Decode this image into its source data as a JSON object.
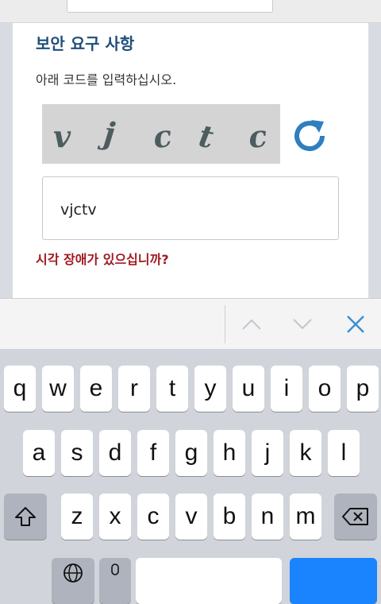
{
  "security": {
    "title": "보안 요구 사항",
    "instruction": "아래 코드를 입력하십시오.",
    "captcha_chars": [
      "v",
      "j",
      "c",
      "t",
      "c"
    ],
    "answer_value": "vjctv",
    "accessibility_link": "시각 장애가 있으십니까?"
  },
  "accessory_bar": {
    "prev_icon": "chevron-up-icon",
    "next_icon": "chevron-down-icon",
    "close_icon": "close-icon",
    "accent": "#3d8fd0"
  },
  "keyboard": {
    "row1": [
      "q",
      "w",
      "e",
      "r",
      "t",
      "y",
      "u",
      "i",
      "o",
      "p"
    ],
    "row2": [
      "a",
      "s",
      "d",
      "f",
      "g",
      "h",
      "j",
      "k",
      "l"
    ],
    "row3": [
      "z",
      "x",
      "c",
      "v",
      "b",
      "n",
      "m"
    ],
    "shift_icon": "shift-icon",
    "delete_icon": "backspace-icon",
    "globe_icon": "globe-icon",
    "mic_icon": "microphone-icon"
  },
  "colors": {
    "title": "#1f4e79",
    "link": "#a01920",
    "refresh": "#2f7fc0"
  }
}
